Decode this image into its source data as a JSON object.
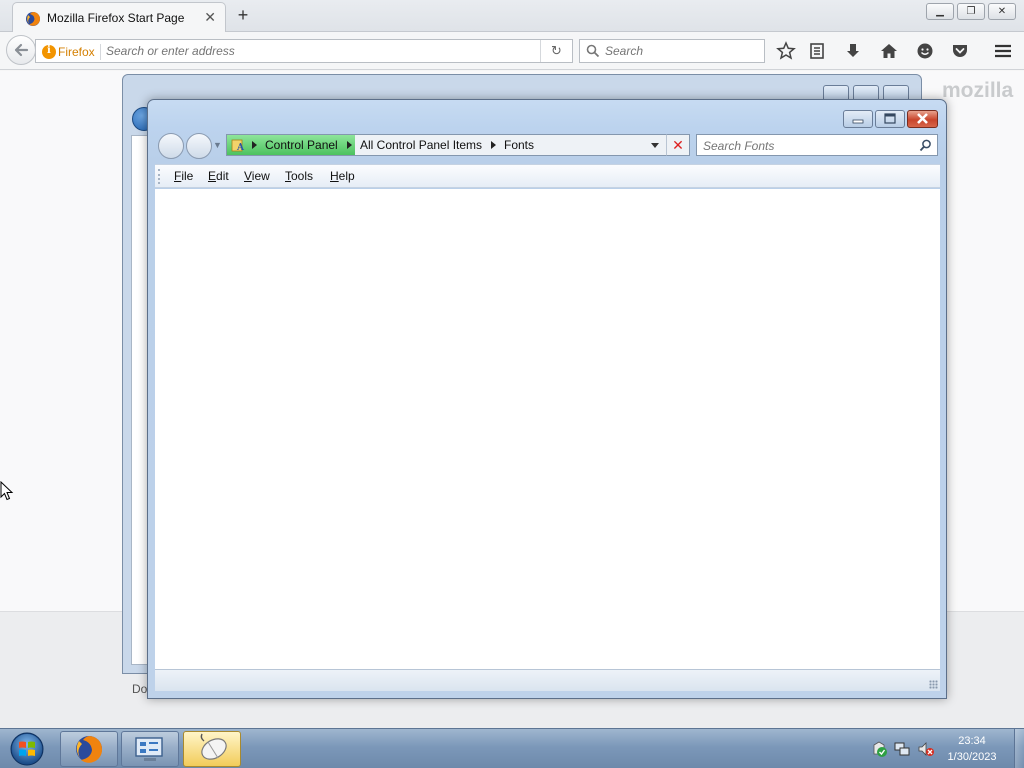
{
  "firefox": {
    "tab_title": "Mozilla Firefox Start Page",
    "identity_label": "Firefox",
    "url_placeholder": "Search or enter address",
    "search_placeholder": "Search",
    "watermark": "mozilla",
    "accent_color": "#f29400"
  },
  "background_window": {
    "status_text": "Do"
  },
  "fonts_window": {
    "breadcrumb": [
      "Control Panel",
      "All Control Panel Items",
      "Fonts"
    ],
    "search_placeholder": "Search Fonts",
    "menu": [
      {
        "accel": "F",
        "rest": "ile"
      },
      {
        "accel": "E",
        "rest": "dit"
      },
      {
        "accel": "V",
        "rest": "iew"
      },
      {
        "accel": "T",
        "rest": "ools"
      },
      {
        "accel": "H",
        "rest": "elp"
      }
    ]
  },
  "taskbar": {
    "time": "23:34",
    "date": "1/30/2023",
    "icons": [
      "windows-start-icon",
      "firefox-icon",
      "control-panel-icon",
      "mouse-icon"
    ]
  }
}
